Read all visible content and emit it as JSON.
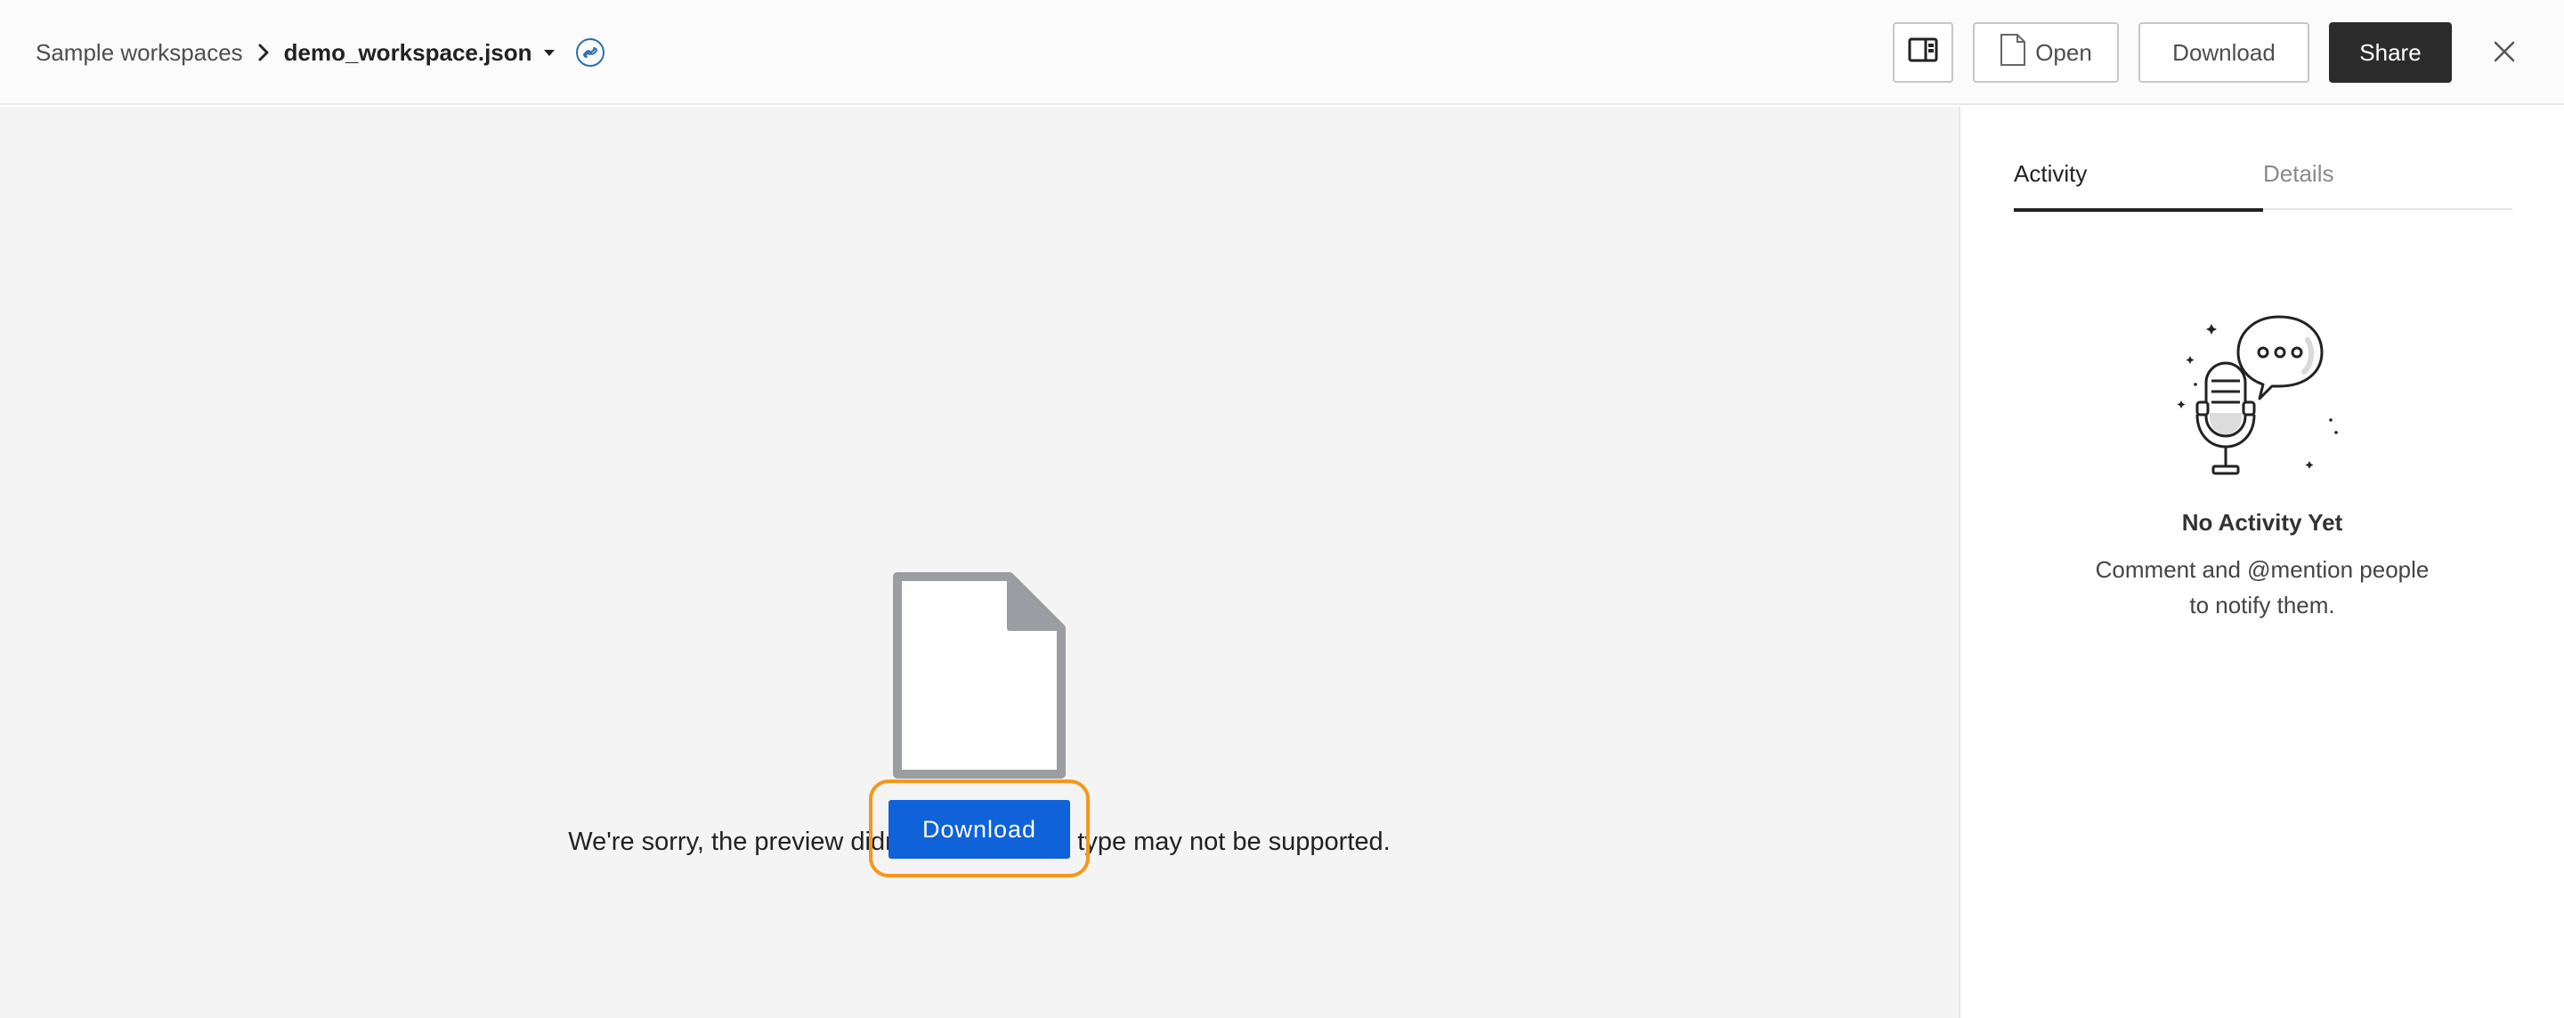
{
  "header": {
    "breadcrumb_parent": "Sample workspaces",
    "file_name": "demo_workspace.json",
    "actions": {
      "open_label": "Open",
      "download_label": "Download",
      "share_label": "Share"
    },
    "icons": [
      "chevron-right-icon",
      "caret-down-icon",
      "link-icon",
      "sidebar-toggle-icon",
      "document-icon",
      "close-icon"
    ]
  },
  "preview": {
    "message": "We're sorry, the preview didn't load. This file type may not be supported.",
    "download_label": "Download",
    "icon": "file-icon"
  },
  "sidebar": {
    "tabs": [
      {
        "label": "Activity",
        "active": true
      },
      {
        "label": "Details",
        "active": false
      }
    ],
    "empty_state": {
      "icon": "microphone-speech-bubble-icon",
      "title": "No Activity Yet",
      "description_line1": "Comment and @mention people",
      "description_line2": "to notify them."
    }
  },
  "colors": {
    "primary": "#0f62d7",
    "focus_ring": "#f5971c",
    "share_button": "#2b2b2b",
    "preview_background": "#f4f4f4"
  }
}
